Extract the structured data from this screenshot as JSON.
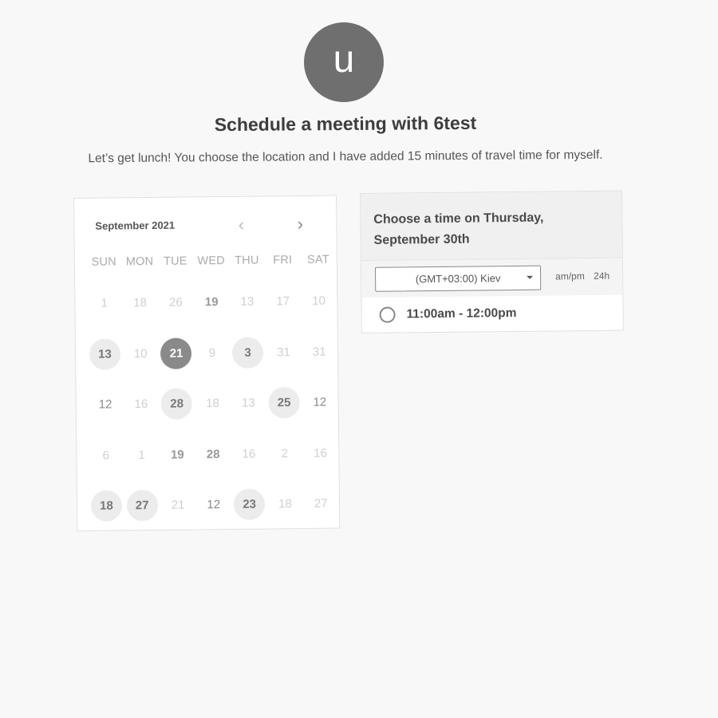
{
  "header": {
    "avatar_initial": "u",
    "title": "Schedule a meeting with 6test",
    "description": "Let’s get lunch! You choose the location and I have added 15 minutes of travel time for myself."
  },
  "calendar": {
    "month_label": "September 2021",
    "prev_icon": "‹",
    "next_icon": "›",
    "weekdays": [
      "SUN",
      "MON",
      "TUE",
      "WED",
      "THU",
      "FRI",
      "SAT"
    ],
    "weeks": [
      [
        {
          "label": "1",
          "state": "faded"
        },
        {
          "label": "18",
          "state": "faded"
        },
        {
          "label": "26",
          "state": "faded"
        },
        {
          "label": "19",
          "state": "bold"
        },
        {
          "label": "13",
          "state": "faded"
        },
        {
          "label": "17",
          "state": "faded"
        },
        {
          "label": "10",
          "state": "faded"
        }
      ],
      [
        {
          "label": "13",
          "state": "available"
        },
        {
          "label": "10",
          "state": "faded"
        },
        {
          "label": "21",
          "state": "selected"
        },
        {
          "label": "9",
          "state": "faded"
        },
        {
          "label": "3",
          "state": "available"
        },
        {
          "label": "31",
          "state": "faded"
        },
        {
          "label": "31",
          "state": "faded"
        }
      ],
      [
        {
          "label": "12",
          "state": "normal"
        },
        {
          "label": "16",
          "state": "faded"
        },
        {
          "label": "28",
          "state": "available"
        },
        {
          "label": "18",
          "state": "faded"
        },
        {
          "label": "13",
          "state": "faded"
        },
        {
          "label": "25",
          "state": "available"
        },
        {
          "label": "12",
          "state": "normal"
        }
      ],
      [
        {
          "label": "6",
          "state": "faded"
        },
        {
          "label": "1",
          "state": "faded"
        },
        {
          "label": "19",
          "state": "bold"
        },
        {
          "label": "28",
          "state": "bold"
        },
        {
          "label": "16",
          "state": "faded"
        },
        {
          "label": "2",
          "state": "faded"
        },
        {
          "label": "16",
          "state": "faded"
        }
      ],
      [
        {
          "label": "18",
          "state": "available"
        },
        {
          "label": "27",
          "state": "available"
        },
        {
          "label": "21",
          "state": "faded"
        },
        {
          "label": "12",
          "state": "normal"
        },
        {
          "label": "23",
          "state": "available"
        },
        {
          "label": "18",
          "state": "faded"
        },
        {
          "label": "27",
          "state": "faded"
        }
      ]
    ]
  },
  "times": {
    "heading_line1": "Choose a time on Thursday,",
    "heading_line2": "September 30th",
    "timezone": "(GMT+03:00) Kiev",
    "format_12h": "am/pm",
    "format_24h": "24h",
    "slots": [
      "11:00am - 12:00pm"
    ]
  }
}
